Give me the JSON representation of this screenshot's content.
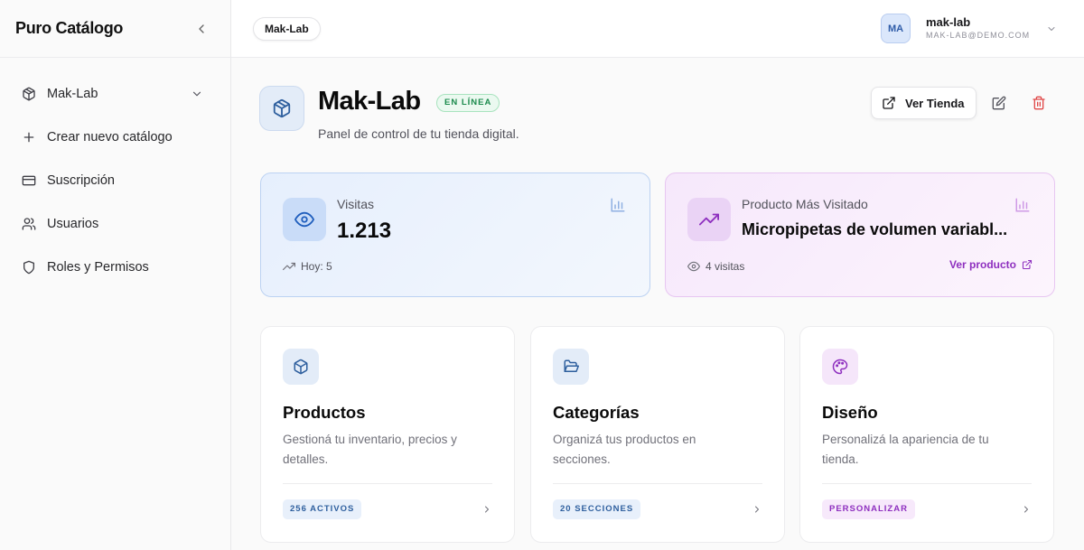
{
  "sidebar": {
    "brand": "Puro Catálogo",
    "items": [
      {
        "label": "Mak-Lab",
        "icon": "box-icon"
      },
      {
        "label": "Crear nuevo catálogo",
        "icon": "plus-icon"
      },
      {
        "label": "Suscripción",
        "icon": "credit-card-icon"
      },
      {
        "label": "Usuarios",
        "icon": "users-icon"
      },
      {
        "label": "Roles y Permisos",
        "icon": "shield-icon"
      }
    ]
  },
  "topbar": {
    "store_pill": "Mak-Lab",
    "user": {
      "initials": "MA",
      "name": "mak-lab",
      "email": "MAK-LAB@DEMO.COM"
    }
  },
  "header": {
    "title": "Mak-Lab",
    "status": "EN LÍNEA",
    "subtitle": "Panel de control de tu tienda digital.",
    "view_store_label": "Ver Tienda"
  },
  "stats": {
    "visits": {
      "label": "Visitas",
      "value": "1.213",
      "today": "Hoy: 5"
    },
    "top_product": {
      "label": "Producto Más Visitado",
      "value": "Micropipetas de volumen variabl...",
      "visits": "4 visitas",
      "link": "Ver producto"
    }
  },
  "cards": [
    {
      "title": "Productos",
      "description": "Gestioná tu inventario, precios y detalles.",
      "badge": "256 ACTIVOS"
    },
    {
      "title": "Categorías",
      "description": "Organizá tus productos en secciones.",
      "badge": "20 SECCIONES"
    },
    {
      "title": "Diseño",
      "description": "Personalizá la apariencia de tu tienda.",
      "badge": "PERSONALIZAR"
    }
  ],
  "colors": {
    "accent_blue": "#2e5f9e",
    "accent_purple": "#8e2fbf",
    "status_green": "#1b8a4c",
    "danger": "#e04848"
  }
}
